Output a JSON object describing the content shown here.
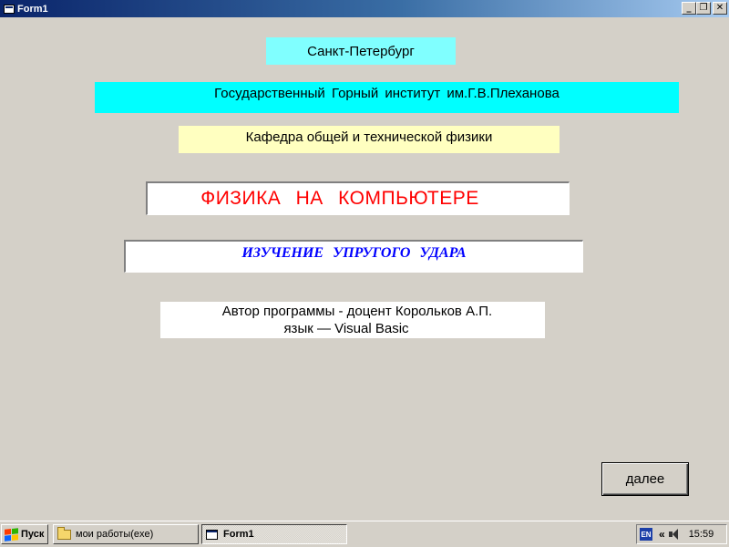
{
  "window": {
    "title": "Form1",
    "buttons": {
      "minimize": "_",
      "restore": "❐",
      "close": "✕"
    }
  },
  "form": {
    "city": "Санкт-Петербург",
    "institute": "Государственный  Горный  институт  им.Г.В.Плеханова",
    "department": "Кафедра общей и технической физики",
    "program_title": "ФИЗИКА   НА   КОМПЬЮТЕРЕ",
    "topic": "ИЗУЧЕНИЕ  УПРУГОГО   УДАРА",
    "author_line1": "Автор программы - доцент  Корольков А.П.",
    "author_line2": "язык — Visual  Basic",
    "next_button": "далее"
  },
  "taskbar": {
    "start_label": "Пуск",
    "tasks": [
      {
        "label": "мои работы(exe)",
        "icon": "folder-icon",
        "active": false
      },
      {
        "label": "Form1",
        "icon": "form-icon",
        "active": true
      }
    ],
    "tray": {
      "language": "EN",
      "chevron": "«",
      "clock": "15:59"
    }
  },
  "colors": {
    "titlebar_start": "#0a246a",
    "titlebar_end": "#a6caf0",
    "form_background": "#d4d0c8",
    "city_background": "#80ffff",
    "institute_background": "#00ffff",
    "department_background": "#ffffc0",
    "program_title_color": "#ff0000",
    "topic_color": "#0000ff"
  }
}
